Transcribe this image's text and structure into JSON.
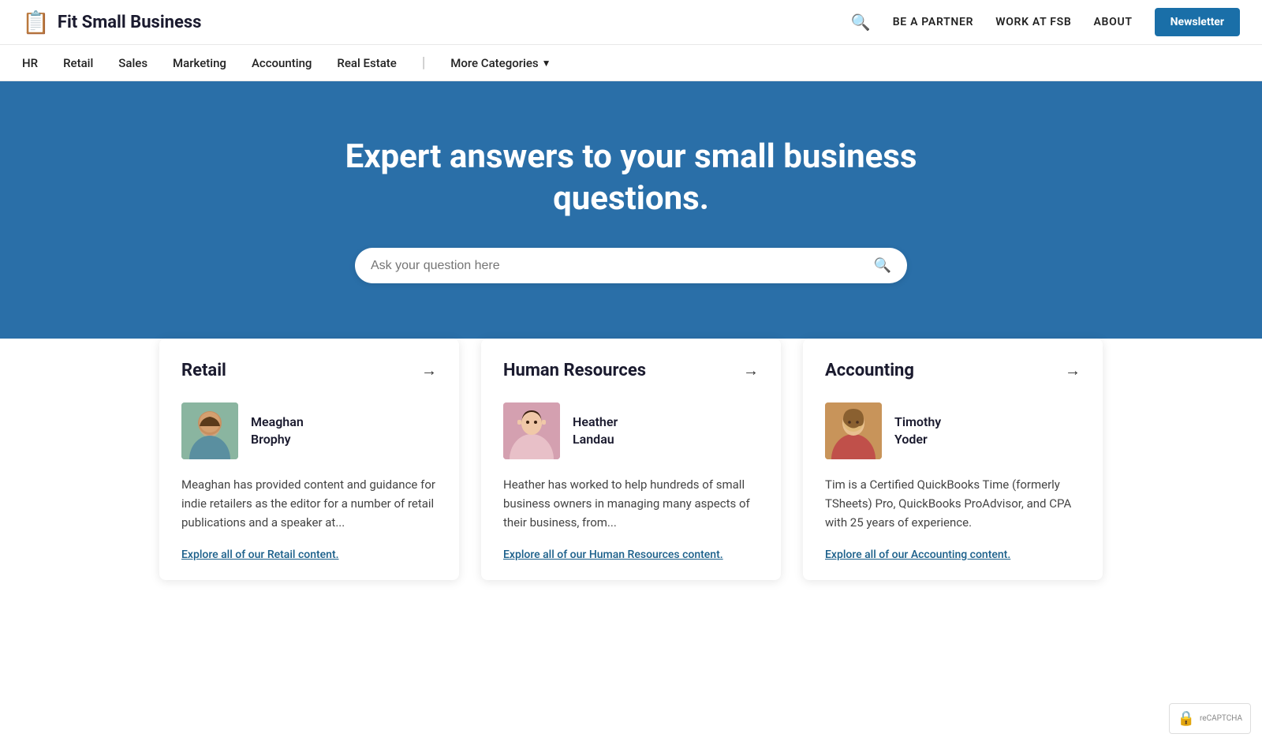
{
  "site": {
    "logo_icon": "📋",
    "logo_text": "Fit Small Business"
  },
  "header": {
    "search_label": "search",
    "partner_label": "BE A PARTNER",
    "work_label": "WORK AT FSB",
    "about_label": "ABOUT",
    "newsletter_label": "Newsletter"
  },
  "nav": {
    "items": [
      {
        "label": "HR",
        "id": "hr"
      },
      {
        "label": "Retail",
        "id": "retail"
      },
      {
        "label": "Sales",
        "id": "sales"
      },
      {
        "label": "Marketing",
        "id": "marketing"
      },
      {
        "label": "Accounting",
        "id": "accounting"
      },
      {
        "label": "Real Estate",
        "id": "real-estate"
      }
    ],
    "more_label": "More Categories"
  },
  "hero": {
    "headline": "Expert answers to your small business questions.",
    "search_placeholder": "Ask your question here"
  },
  "cards": [
    {
      "id": "retail",
      "title": "Retail",
      "author_name": "Meaghan\nBrophy",
      "avatar_emoji": "👩",
      "avatar_class": "avatar-retail",
      "description": "Meaghan has provided content and guidance for indie retailers as the editor for a number of retail publications and a speaker at...",
      "link_text": "Explore all of our Retail content."
    },
    {
      "id": "hr",
      "title": "Human Resources",
      "author_name": "Heather\nLandau",
      "avatar_emoji": "👩",
      "avatar_class": "avatar-hr",
      "description": "Heather has worked to help hundreds of small business owners in managing many aspects of their business, from...",
      "link_text": "Explore all of our Human Resources content."
    },
    {
      "id": "accounting",
      "title": "Accounting",
      "author_name": "Timothy\nYoder",
      "avatar_emoji": "👨",
      "avatar_class": "avatar-accounting",
      "description": "Tim is a Certified QuickBooks Time (formerly TSheets) Pro, QuickBooks ProAdvisor, and CPA with 25 years of experience.",
      "link_text": "Explore all of our Accounting content."
    }
  ],
  "recaptcha": {
    "label": "reCAPTCHA"
  }
}
